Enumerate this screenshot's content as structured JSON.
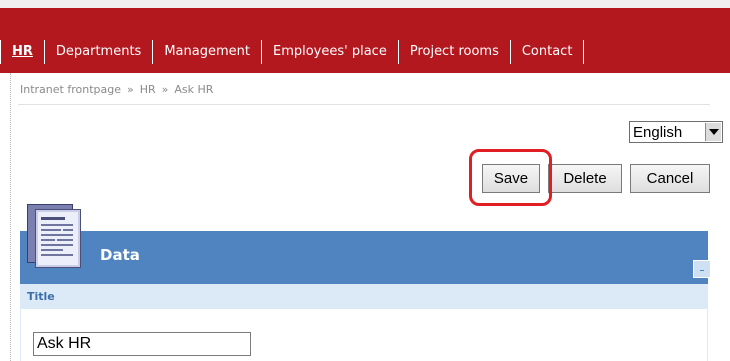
{
  "nav": {
    "items": [
      {
        "label": "HR",
        "active": true
      },
      {
        "label": "Departments",
        "active": false
      },
      {
        "label": "Management",
        "active": false
      },
      {
        "label": "Employees' place",
        "active": false
      },
      {
        "label": "Project rooms",
        "active": false
      },
      {
        "label": "Contact",
        "active": false
      }
    ]
  },
  "breadcrumb": {
    "items": [
      "Intranet frontpage",
      "HR",
      "Ask HR"
    ],
    "separator": "»"
  },
  "language": {
    "selected": "English"
  },
  "actions": {
    "save": "Save",
    "delete": "Delete",
    "cancel": "Cancel"
  },
  "panel": {
    "title": "Data",
    "collapse": "-",
    "icon": "document-icon"
  },
  "fields": {
    "title_label": "Title",
    "title_value": "Ask HR"
  },
  "colors": {
    "nav_bg": "#b3181f",
    "panel_header": "#4f84c0",
    "panel_row": "#dce9f7",
    "highlight": "#e01e24"
  }
}
